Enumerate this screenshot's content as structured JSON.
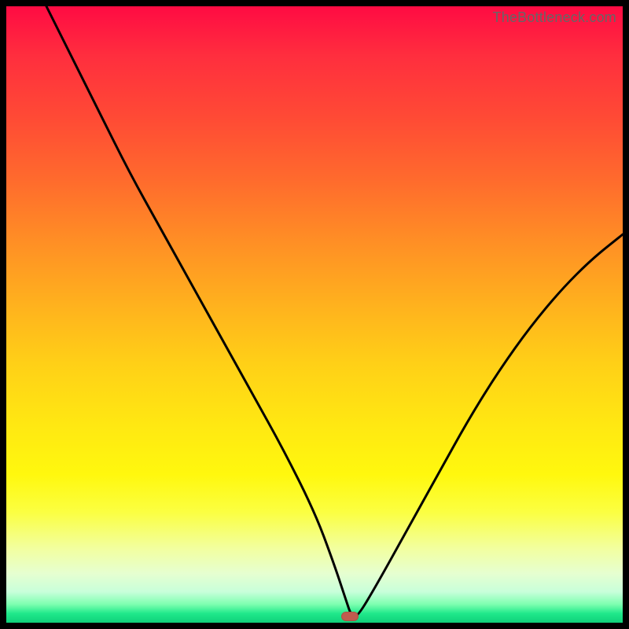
{
  "watermark": "TheBottleneck.com",
  "marker": {
    "x_pct": 55.8,
    "y_pct_from_bottom": 1.0
  },
  "chart_data": {
    "type": "line",
    "title": "",
    "xlabel": "",
    "ylabel": "",
    "xlim": [
      0,
      100
    ],
    "ylim": [
      0,
      100
    ],
    "background_gradient": {
      "top_color": "#ff0b43",
      "bottom_color": "#0fd07a",
      "note": "vertical red→orange→yellow→green gradient; green only at very bottom"
    },
    "series": [
      {
        "name": "bottleneck-curve",
        "note": "V-shaped curve: descends from top-left, minimum near x≈56 at bottom, rises to mid-right edge",
        "x": [
          6.5,
          10,
          15,
          20,
          25,
          30,
          35,
          40,
          45,
          50,
          53,
          55,
          56,
          57,
          60,
          65,
          70,
          75,
          80,
          85,
          90,
          95,
          100
        ],
        "y": [
          100,
          93,
          83,
          73,
          64,
          55,
          46,
          37,
          28,
          18,
          10,
          4,
          1,
          1,
          6,
          15,
          24,
          33,
          41,
          48,
          54,
          59,
          63
        ]
      }
    ],
    "marker_point": {
      "x": 56,
      "y": 1,
      "color": "#c15b4e",
      "shape": "rounded-rect"
    }
  }
}
